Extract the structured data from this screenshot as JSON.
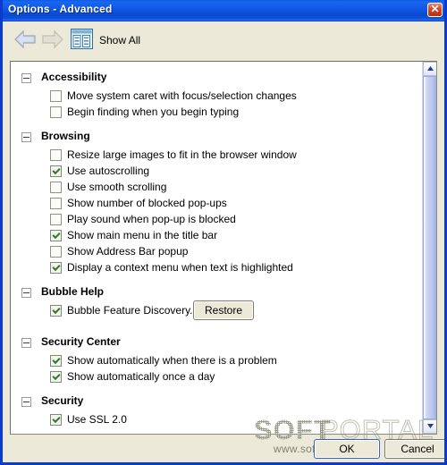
{
  "window": {
    "title": "Options - Advanced",
    "close_icon": "close-icon",
    "close_glyph": "✕"
  },
  "toolbar": {
    "back_icon": "back-arrow-icon",
    "forward_icon": "forward-arrow-icon",
    "showall_icon": "show-all-icon",
    "showall_label": "Show All"
  },
  "sections": [
    {
      "title": "Accessibility",
      "items": [
        {
          "label": "Move system caret with focus/selection changes",
          "checked": false
        },
        {
          "label": "Begin finding when you begin typing",
          "checked": false
        }
      ]
    },
    {
      "title": "Browsing",
      "items": [
        {
          "label": "Resize large images to fit in the browser window",
          "checked": false
        },
        {
          "label": "Use autoscrolling",
          "checked": true
        },
        {
          "label": "Use smooth scrolling",
          "checked": false
        },
        {
          "label": "Show number of blocked pop-ups",
          "checked": false
        },
        {
          "label": "Play sound when pop-up is blocked",
          "checked": false
        },
        {
          "label": "Show main menu in the title bar",
          "checked": true
        },
        {
          "label": "Show Address Bar popup",
          "checked": false
        },
        {
          "label": "Display a context menu when text is highlighted",
          "checked": true
        }
      ]
    },
    {
      "title": "Bubble Help",
      "items": [
        {
          "label": "Bubble Feature Discovery.",
          "checked": true,
          "button": "Restore"
        }
      ]
    },
    {
      "title": "Security Center",
      "items": [
        {
          "label": "Show automatically when there is a problem",
          "checked": true
        },
        {
          "label": "Show automatically once a day",
          "checked": true
        }
      ]
    },
    {
      "title": "Security",
      "items": [
        {
          "label": "Use SSL 2.0",
          "checked": true
        }
      ]
    }
  ],
  "scrollbar": {
    "up_icon": "chevron-up-icon",
    "down_icon": "chevron-down-icon"
  },
  "footer": {
    "ok_label": "OK",
    "cancel_label": "Cancel"
  },
  "watermark": {
    "word1": "SOFT",
    "word2": "PORTAL",
    "url": "www.softportal.com"
  },
  "colors": {
    "titlebar_blue": "#0b57e3",
    "window_frame": "#0a3ad0",
    "dialog_face": "#ece9d8",
    "list_bg": "#ffffff",
    "check_green": "#2f7a2f",
    "close_red": "#d8482a"
  }
}
